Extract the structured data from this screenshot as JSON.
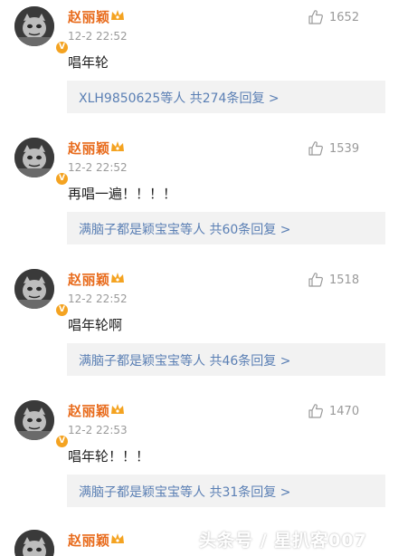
{
  "colors": {
    "username": "#e86b1c",
    "link": "#5a7fb4",
    "muted": "#9a9a9a",
    "reply_bg": "#f2f2f2"
  },
  "comments": [
    {
      "user": "赵丽颖",
      "time": "12-2 22:52",
      "likes": "1652",
      "text": "唱年轮",
      "reply_summary": "XLH9850625等人  共274条回复 >"
    },
    {
      "user": "赵丽颖",
      "time": "12-2 22:52",
      "likes": "1539",
      "text": "再唱一遍！！！！",
      "reply_summary": "满脑子都是颖宝宝等人  共60条回复 >"
    },
    {
      "user": "赵丽颖",
      "time": "12-2 22:52",
      "likes": "1518",
      "text": "唱年轮啊",
      "reply_summary": "满脑子都是颖宝宝等人  共46条回复 >"
    },
    {
      "user": "赵丽颖",
      "time": "12-2 22:53",
      "likes": "1470",
      "text": "唱年轮！！！",
      "reply_summary": "满脑子都是颖宝宝等人  共31条回复 >"
    },
    {
      "user": "赵丽颖"
    }
  ],
  "watermark": "头条号 / 星扒客007",
  "icons": {
    "like": "thumbs-up-icon",
    "verified": "verified-v-icon",
    "membership": "crown-icon"
  }
}
